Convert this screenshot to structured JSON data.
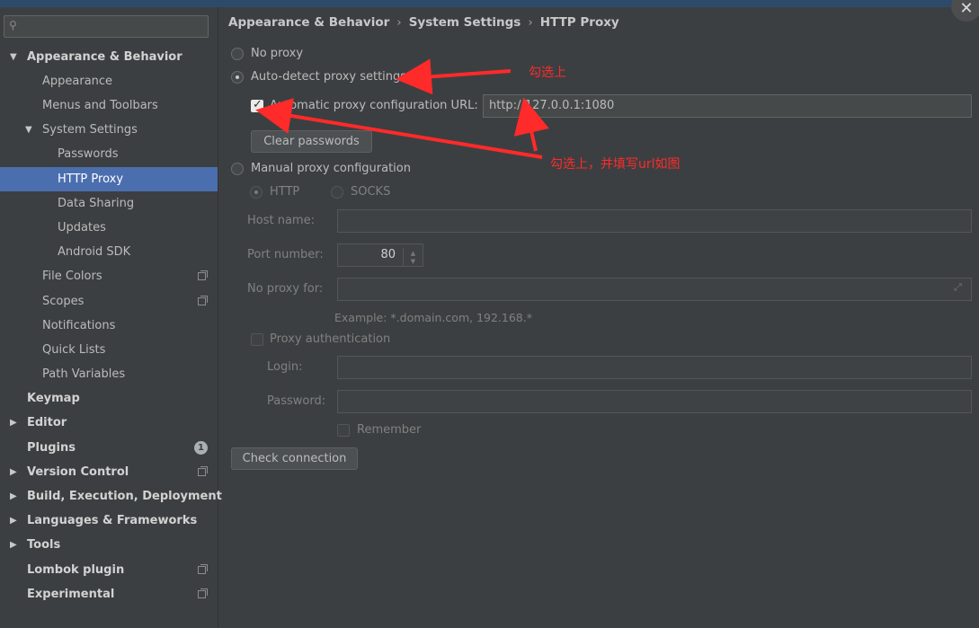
{
  "sidebar": {
    "search_placeholder": "",
    "items": [
      {
        "label": "Appearance & Behavior",
        "bold": true,
        "arrow": "▼"
      },
      {
        "label": "Appearance"
      },
      {
        "label": "Menus and Toolbars"
      },
      {
        "label": "System Settings",
        "arrow": "▼"
      },
      {
        "label": "Passwords"
      },
      {
        "label": "HTTP Proxy",
        "selected": true
      },
      {
        "label": "Data Sharing"
      },
      {
        "label": "Updates"
      },
      {
        "label": "Android SDK"
      },
      {
        "label": "File Colors",
        "icon": "copy-icon"
      },
      {
        "label": "Scopes",
        "icon": "copy-icon"
      },
      {
        "label": "Notifications"
      },
      {
        "label": "Quick Lists"
      },
      {
        "label": "Path Variables"
      },
      {
        "label": "Keymap",
        "bold": true
      },
      {
        "label": "Editor",
        "bold": true,
        "arrow": "▶"
      },
      {
        "label": "Plugins",
        "bold": true,
        "badge": "1"
      },
      {
        "label": "Version Control",
        "bold": true,
        "arrow": "▶",
        "icon": "copy-icon"
      },
      {
        "label": "Build, Execution, Deployment",
        "bold": true,
        "arrow": "▶"
      },
      {
        "label": "Languages & Frameworks",
        "bold": true,
        "arrow": "▶"
      },
      {
        "label": "Tools",
        "bold": true,
        "arrow": "▶"
      },
      {
        "label": "Lombok plugin",
        "bold": true,
        "icon": "copy-icon"
      },
      {
        "label": "Experimental",
        "bold": true,
        "icon": "copy-icon"
      }
    ]
  },
  "breadcrumb": {
    "parts": [
      "Appearance & Behavior",
      "System Settings",
      "HTTP Proxy"
    ],
    "separator": "›"
  },
  "proxy": {
    "no_proxy_label": "No proxy",
    "auto_detect_label": "Auto-detect proxy settings",
    "auto_config_url_label": "Automatic proxy configuration URL:",
    "auto_config_url_value": "http://127.0.0.1:1080",
    "auto_config_checked": true,
    "clear_passwords_label": "Clear passwords",
    "manual_label": "Manual proxy configuration",
    "http_label": "HTTP",
    "socks_label": "SOCKS",
    "host_name_label": "Host name:",
    "host_name_value": "",
    "port_number_label": "Port number:",
    "port_number_value": "80",
    "no_proxy_for_label": "No proxy for:",
    "no_proxy_for_value": "",
    "example_text": "Example: *.domain.com, 192.168.*",
    "proxy_auth_label": "Proxy authentication",
    "login_label": "Login:",
    "password_label": "Password:",
    "remember_label": "Remember",
    "check_connection_label": "Check connection",
    "selected_mode": "auto-detect"
  },
  "annotations": {
    "note1": "勾选上",
    "note2": "勾选上，并填写url如图",
    "color": "#ff2a2a"
  },
  "window": {
    "close_glyph": "✕"
  }
}
